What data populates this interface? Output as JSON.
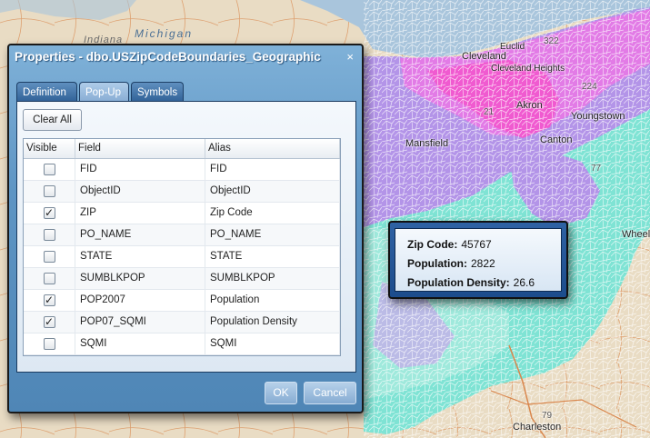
{
  "map": {
    "lake_label": "Michigan",
    "state_label": "Indiana",
    "cities": [
      "Cleveland",
      "Euclid",
      "Cleveland Heights",
      "Akron",
      "Youngstown",
      "Canton",
      "Mansfield",
      "Wheeling",
      "Charleston"
    ],
    "road_labels": [
      "322",
      "224",
      "77",
      "21",
      "79"
    ],
    "colors": {
      "land": "#e9dcc4",
      "water": "#a9c5dc",
      "magenta": "#e27be6",
      "cyan": "#7fe3d4",
      "lavender": "#b394e8",
      "pink": "#f05ad0"
    }
  },
  "dialog": {
    "title": "Properties - dbo.USZipCodeBoundaries_Geographic",
    "close_icon": "×",
    "tabs": [
      {
        "label": "Definition"
      },
      {
        "label": "Pop-Up"
      },
      {
        "label": "Symbols"
      }
    ],
    "active_tab": "Pop-Up",
    "clear_all_label": "Clear All",
    "columns": {
      "visible": "Visible",
      "field": "Field",
      "alias": "Alias"
    },
    "rows": [
      {
        "field": "FID",
        "alias": "FID",
        "checked": false,
        "check_mark": ""
      },
      {
        "field": "ObjectID",
        "alias": "ObjectID",
        "checked": false,
        "check_mark": ""
      },
      {
        "field": "ZIP",
        "alias": "Zip Code",
        "checked": true,
        "check_mark": "✓"
      },
      {
        "field": "PO_NAME",
        "alias": "PO_NAME",
        "checked": false,
        "check_mark": ""
      },
      {
        "field": "STATE",
        "alias": "STATE",
        "checked": false,
        "check_mark": ""
      },
      {
        "field": "SUMBLKPOP",
        "alias": "SUMBLKPOP",
        "checked": false,
        "check_mark": ""
      },
      {
        "field": "POP2007",
        "alias": "Population",
        "checked": true,
        "check_mark": "✓"
      },
      {
        "field": "POP07_SQMI",
        "alias": "Population Density",
        "checked": true,
        "check_mark": "✓"
      },
      {
        "field": "SQMI",
        "alias": "SQMI",
        "checked": false,
        "check_mark": ""
      }
    ],
    "ok_label": "OK",
    "cancel_label": "Cancel"
  },
  "popup": {
    "lines": [
      {
        "label": "Zip Code:",
        "value": "45767"
      },
      {
        "label": "Population:",
        "value": "2822"
      },
      {
        "label": "Population Density:",
        "value": "26.6"
      }
    ]
  }
}
